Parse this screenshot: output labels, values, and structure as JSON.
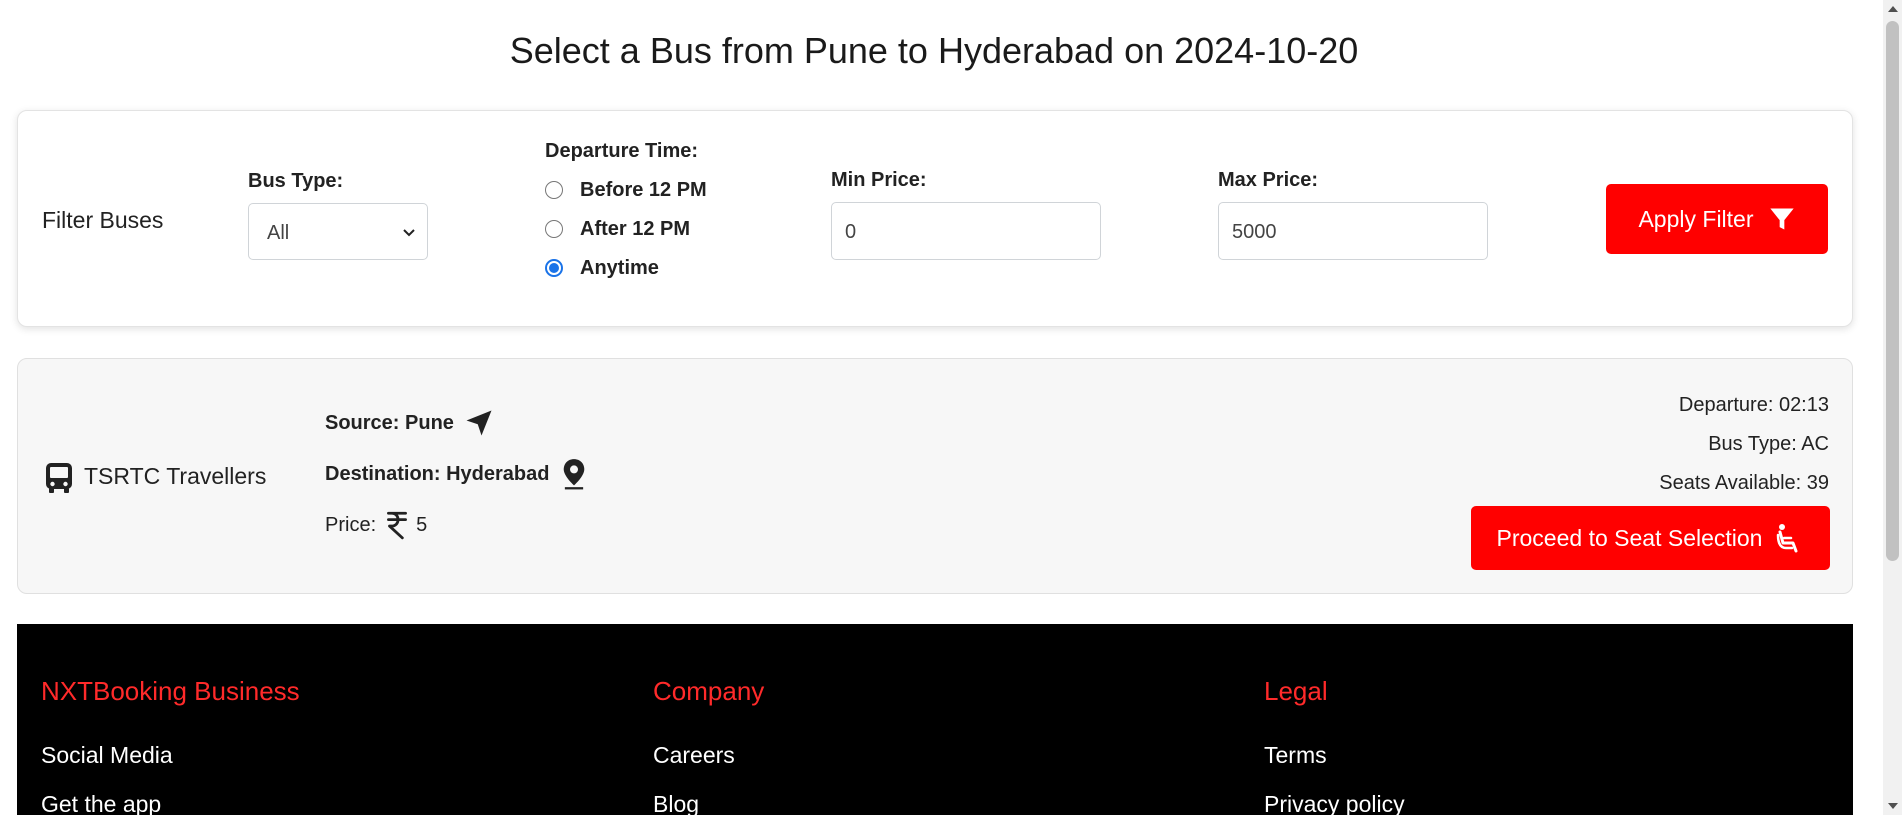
{
  "page": {
    "title": "Select a Bus from Pune to Hyderabad on 2024-10-20"
  },
  "filters": {
    "heading": "Filter Buses",
    "bus_type": {
      "label": "Bus Type:",
      "selected": "All"
    },
    "departure_time": {
      "label": "Departure Time:",
      "options": [
        {
          "label": "Before 12 PM",
          "checked": false
        },
        {
          "label": "After 12 PM",
          "checked": false
        },
        {
          "label": "Anytime",
          "checked": true
        }
      ]
    },
    "min_price": {
      "label": "Min Price:",
      "value": "0"
    },
    "max_price": {
      "label": "Max Price:",
      "value": "5000"
    },
    "apply_button": {
      "label": "Apply Filter",
      "icon": "filter-icon"
    }
  },
  "bus": {
    "name": "TSRTC Travellers",
    "icon": "bus-icon",
    "source": "Source: Pune",
    "source_icon": "navigation-arrow-icon",
    "destination": "Destination: Hyderabad",
    "destination_icon": "map-pin-icon",
    "price_label": "Price:",
    "price_icon": "rupee-icon",
    "price_value": "5",
    "departure": "Departure: 02:13",
    "bus_type": "Bus Type: AC",
    "seats_available": "Seats Available: 39",
    "proceed_button": {
      "label": "Proceed to Seat Selection",
      "icon": "seat-icon"
    }
  },
  "footer": {
    "columns": [
      {
        "heading": "NXTBooking Business",
        "links": [
          "Social Media",
          "Get the app"
        ]
      },
      {
        "heading": "Company",
        "links": [
          "Careers",
          "Blog"
        ]
      },
      {
        "heading": "Legal",
        "links": [
          "Terms",
          "Privacy policy"
        ]
      }
    ]
  },
  "colors": {
    "accent": "#ff0000",
    "footer_heading": "#ff2a2a",
    "footer_bg": "#000000",
    "radio_checked": "#1a73e8"
  }
}
